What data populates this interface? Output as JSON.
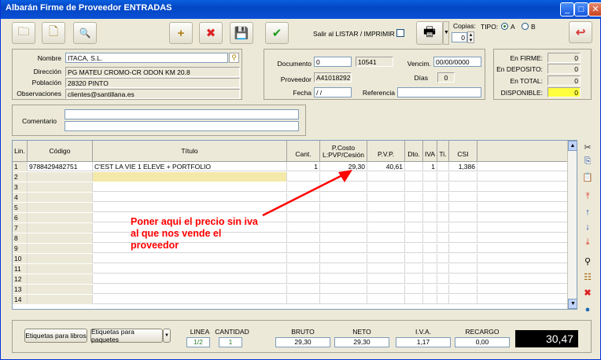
{
  "window": {
    "title": "Albarán Firme de Proveedor ENTRADAS",
    "min": "_",
    "max": "□",
    "close": "✕"
  },
  "toolbar": {
    "salir_label": "Salir al LISTAR / IMPRIMIR",
    "copias_label": "Copias:",
    "copias_value": "0",
    "tipo_label": "TIPO:",
    "tipo_a": "A",
    "tipo_b": "B"
  },
  "icons": {
    "open": "🗀",
    "new": "🗋",
    "search": "🔍",
    "add": "+",
    "delete": "✖",
    "save": "💾",
    "ok": "✔",
    "print": "🖶",
    "exit": "↩"
  },
  "prov": {
    "nombre_label": "Nombre",
    "nombre": "ITACA, S.L.",
    "direccion_label": "Dirección",
    "direccion": "PG MATEU CROMO-CR ODON KM 20.8",
    "poblacion_label": "Población",
    "poblacion": "28320 PINTO",
    "obs_label": "Observaciones",
    "obs": "clientes@santillana.es"
  },
  "doc": {
    "documento_label": "Documento",
    "documento": "0",
    "numero": "10541",
    "vencim_label": "Vencim.",
    "vencim": "00/00/0000",
    "proveedor_label": "Proveedor",
    "proveedor": "A41018292",
    "dias_label": "Días",
    "dias": "0",
    "fecha_label": "Fecha",
    "fecha": "/ /",
    "referencia_label": "Referencia",
    "referencia": ""
  },
  "stock": {
    "firme_label": "En FIRME:",
    "firme": "0",
    "deposito_label": "En DEPOSITO:",
    "deposito": "0",
    "total_label": "En TOTAL:",
    "total": "0",
    "disp_label": "DISPONIBLE:",
    "disp": "0"
  },
  "comentario_label": "Comentario",
  "grid": {
    "headers": [
      "Lin.",
      "Código",
      "Título",
      "Cant.",
      "P.Costo L:PVP/Cesión",
      "P.V.P.",
      "Dto.",
      "IVA",
      "Ti.",
      "CSI"
    ],
    "row1": {
      "lin": "1",
      "codigo": "9788429482751",
      "titulo": "C'EST LA VIE 1 ELEVE + PORTFOLIO",
      "cant": "1",
      "pcosto": "29,30",
      "pvp": "40,61",
      "dto": "",
      "iva": "1",
      "ti": "",
      "csi": "1,386"
    },
    "lines": [
      "2",
      "3",
      "4",
      "5",
      "6",
      "7",
      "8",
      "9",
      "10",
      "11",
      "12",
      "13",
      "14"
    ]
  },
  "annotation": "Poner aqui el precio sin iva al que nos vende el proveedor",
  "annotation_color": "#ff0000",
  "bottom": {
    "etiq_libros": "Etiquetas para libros",
    "etiq_paquetes": "Etiquetas para paquetes",
    "linea_label": "LINEA",
    "linea": "1/2",
    "cantidad_label": "CANTIDAD",
    "cantidad": "1",
    "bruto_label": "BRUTO",
    "bruto": "29,30",
    "neto_label": "NETO",
    "neto": "29,30",
    "iva_label": "I.V.A.",
    "iva": "1,17",
    "recargo_label": "RECARGO",
    "recargo": "0,00",
    "total": "30,47"
  }
}
